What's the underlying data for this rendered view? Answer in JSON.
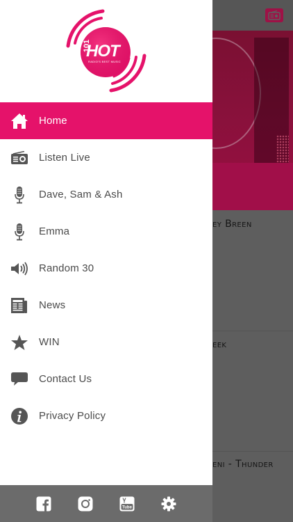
{
  "drawer": {
    "logo": {
      "text": "HOT",
      "frequency": "101",
      "tagline": "RADIO'S BEST MUSIC"
    },
    "nav": [
      {
        "label": "Home",
        "icon": "home-icon"
      },
      {
        "label": "Listen Live",
        "icon": "radio-icon"
      },
      {
        "label": "Dave, Sam & Ash",
        "icon": "microphone-icon"
      },
      {
        "label": "Emma",
        "icon": "microphone-icon"
      },
      {
        "label": "Random 30",
        "icon": "speaker-icon"
      },
      {
        "label": "News",
        "icon": "newspaper-icon"
      },
      {
        "label": "WIN",
        "icon": "star-icon"
      },
      {
        "label": "Contact Us",
        "icon": "chat-bubble-icon"
      },
      {
        "label": "Privacy Policy",
        "icon": "info-icon"
      }
    ],
    "active_index": 0,
    "footer": [
      "facebook-icon",
      "instagram-icon",
      "youtube-icon",
      "settings-icon"
    ]
  },
  "background": {
    "items": [
      "ey Breen",
      "eek",
      "eni - Thunder"
    ]
  },
  "colors": {
    "accent": "#e5126a",
    "footer": "#6b6b6b",
    "text": "#4a4a4a",
    "icon": "#555555"
  }
}
